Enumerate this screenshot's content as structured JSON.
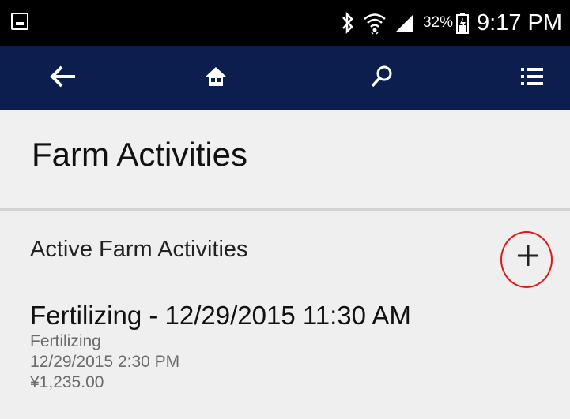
{
  "status_bar": {
    "left_icon": "image-notification-icon",
    "icons": [
      "bluetooth-icon",
      "wifi-icon",
      "signal-icon",
      "battery-icon"
    ],
    "battery_percent": "32%",
    "time": "9:17 PM"
  },
  "app_bar": {
    "background": "#0c1e4e",
    "buttons": [
      "back-arrow-icon",
      "home-icon",
      "search-icon",
      "list-menu-icon"
    ]
  },
  "header": {
    "title": "Farm Activities"
  },
  "section": {
    "title": "Active Farm Activities",
    "add_button_icon": "plus-icon",
    "highlight_color": "#e01818"
  },
  "activities": [
    {
      "title": "Fertilizing - 12/29/2015 11:30 AM",
      "type": "Fertilizing",
      "datetime": "12/29/2015 2:30 PM",
      "amount": "¥1,235.00"
    }
  ]
}
